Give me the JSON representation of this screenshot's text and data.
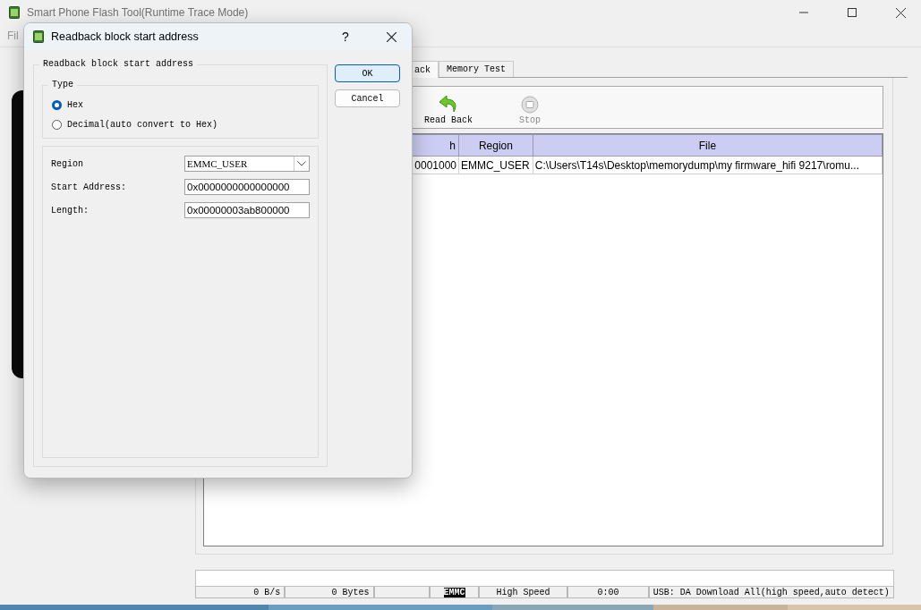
{
  "main_window": {
    "title": "Smart Phone Flash Tool(Runtime Trace Mode)",
    "menu": [
      "Fil"
    ],
    "tabs": [
      {
        "label": "ack",
        "selected": true
      },
      {
        "label": "Memory Test",
        "selected": false
      }
    ],
    "toolbar": [
      {
        "label": "Read Back",
        "kind": "readback",
        "disabled": false
      },
      {
        "label": "Stop",
        "kind": "stop",
        "disabled": true
      }
    ],
    "table": {
      "columns": [
        "h",
        "Region",
        "File"
      ],
      "rows": [
        [
          "0001000",
          "EMMC_USER",
          "C:\\Users\\T14s\\Desktop\\memorydump\\my firmware_hifi 9217\\romu..."
        ]
      ]
    },
    "status_bar": [
      {
        "text": "0 B/s",
        "kind": "plain"
      },
      {
        "text": "0 Bytes",
        "kind": "plain"
      },
      {
        "kind": "blank"
      },
      {
        "text": "EMMC",
        "kind": "inverted"
      },
      {
        "text": "High Speed",
        "kind": "centered"
      },
      {
        "text": "0:00",
        "kind": "centered"
      },
      {
        "text": "USB: DA Download All(high speed,auto detect)",
        "kind": "left"
      }
    ]
  },
  "dialog": {
    "title": "Readback block start address",
    "help": "?",
    "group_title": "Readback block start address",
    "type_title": "Type",
    "types": [
      {
        "label": "Hex",
        "selected": true
      },
      {
        "label": "Decimal(auto convert to Hex)",
        "selected": false
      }
    ],
    "fields": [
      {
        "label": "Region",
        "kind": "combo",
        "value": "EMMC_USER"
      },
      {
        "label": "Start Address:",
        "kind": "text",
        "value": "0x0000000000000000"
      },
      {
        "label": "Length:",
        "kind": "text",
        "value": "0x00000003ab800000"
      }
    ],
    "buttons": [
      {
        "label": "OK",
        "default": true
      },
      {
        "label": "Cancel",
        "default": false
      }
    ]
  }
}
